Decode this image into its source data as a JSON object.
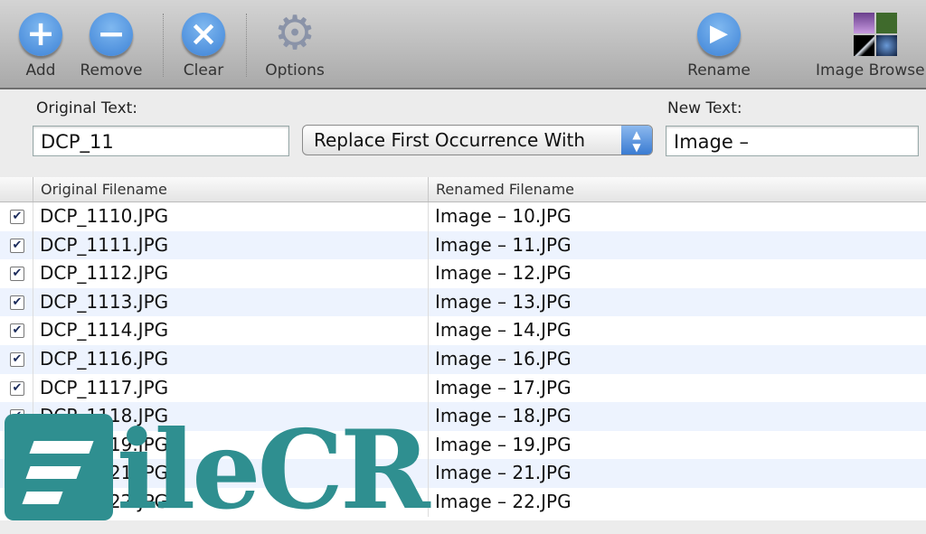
{
  "toolbar": {
    "add": {
      "label": "Add",
      "icon": "plus-icon"
    },
    "remove": {
      "label": "Remove",
      "icon": "minus-icon"
    },
    "clear": {
      "label": "Clear",
      "icon": "x-icon"
    },
    "options": {
      "label": "Options",
      "icon": "gear-icon"
    },
    "rename": {
      "label": "Rename",
      "icon": "play-icon"
    },
    "image_browser": {
      "label": "Image Browse",
      "icon": "image-browser-icon"
    }
  },
  "form": {
    "original_label": "Original Text:",
    "original_value": "DCP_11",
    "mode_value": "Replace First Occurrence With",
    "new_label": "New Text:",
    "new_value": "Image –"
  },
  "table": {
    "headers": [
      "Original Filename",
      "Renamed Filename"
    ],
    "rows": [
      {
        "checked": true,
        "original": "DCP_1110.JPG",
        "renamed": "Image – 10.JPG"
      },
      {
        "checked": true,
        "original": "DCP_1111.JPG",
        "renamed": "Image – 11.JPG"
      },
      {
        "checked": true,
        "original": "DCP_1112.JPG",
        "renamed": "Image – 12.JPG"
      },
      {
        "checked": true,
        "original": "DCP_1113.JPG",
        "renamed": "Image – 13.JPG"
      },
      {
        "checked": true,
        "original": "DCP_1114.JPG",
        "renamed": "Image – 14.JPG"
      },
      {
        "checked": true,
        "original": "DCP_1116.JPG",
        "renamed": "Image – 16.JPG"
      },
      {
        "checked": true,
        "original": "DCP_1117.JPG",
        "renamed": "Image – 17.JPG"
      },
      {
        "checked": true,
        "original": "DCP_1118.JPG",
        "renamed": "Image – 18.JPG"
      },
      {
        "checked": true,
        "original": "DCP_1119.JPG",
        "renamed": "Image – 19.JPG"
      },
      {
        "checked": true,
        "original": "DCP_1121.JPG",
        "renamed": "Image – 21.JPG"
      },
      {
        "checked": true,
        "original": "DCP_1122.JPG",
        "renamed": "Image – 22.JPG"
      }
    ]
  },
  "watermark": {
    "text": "FileCR",
    "color": "#2f8f90"
  },
  "colors": {
    "accent": "#3d82d6",
    "row_alt": "#edf3fe"
  }
}
